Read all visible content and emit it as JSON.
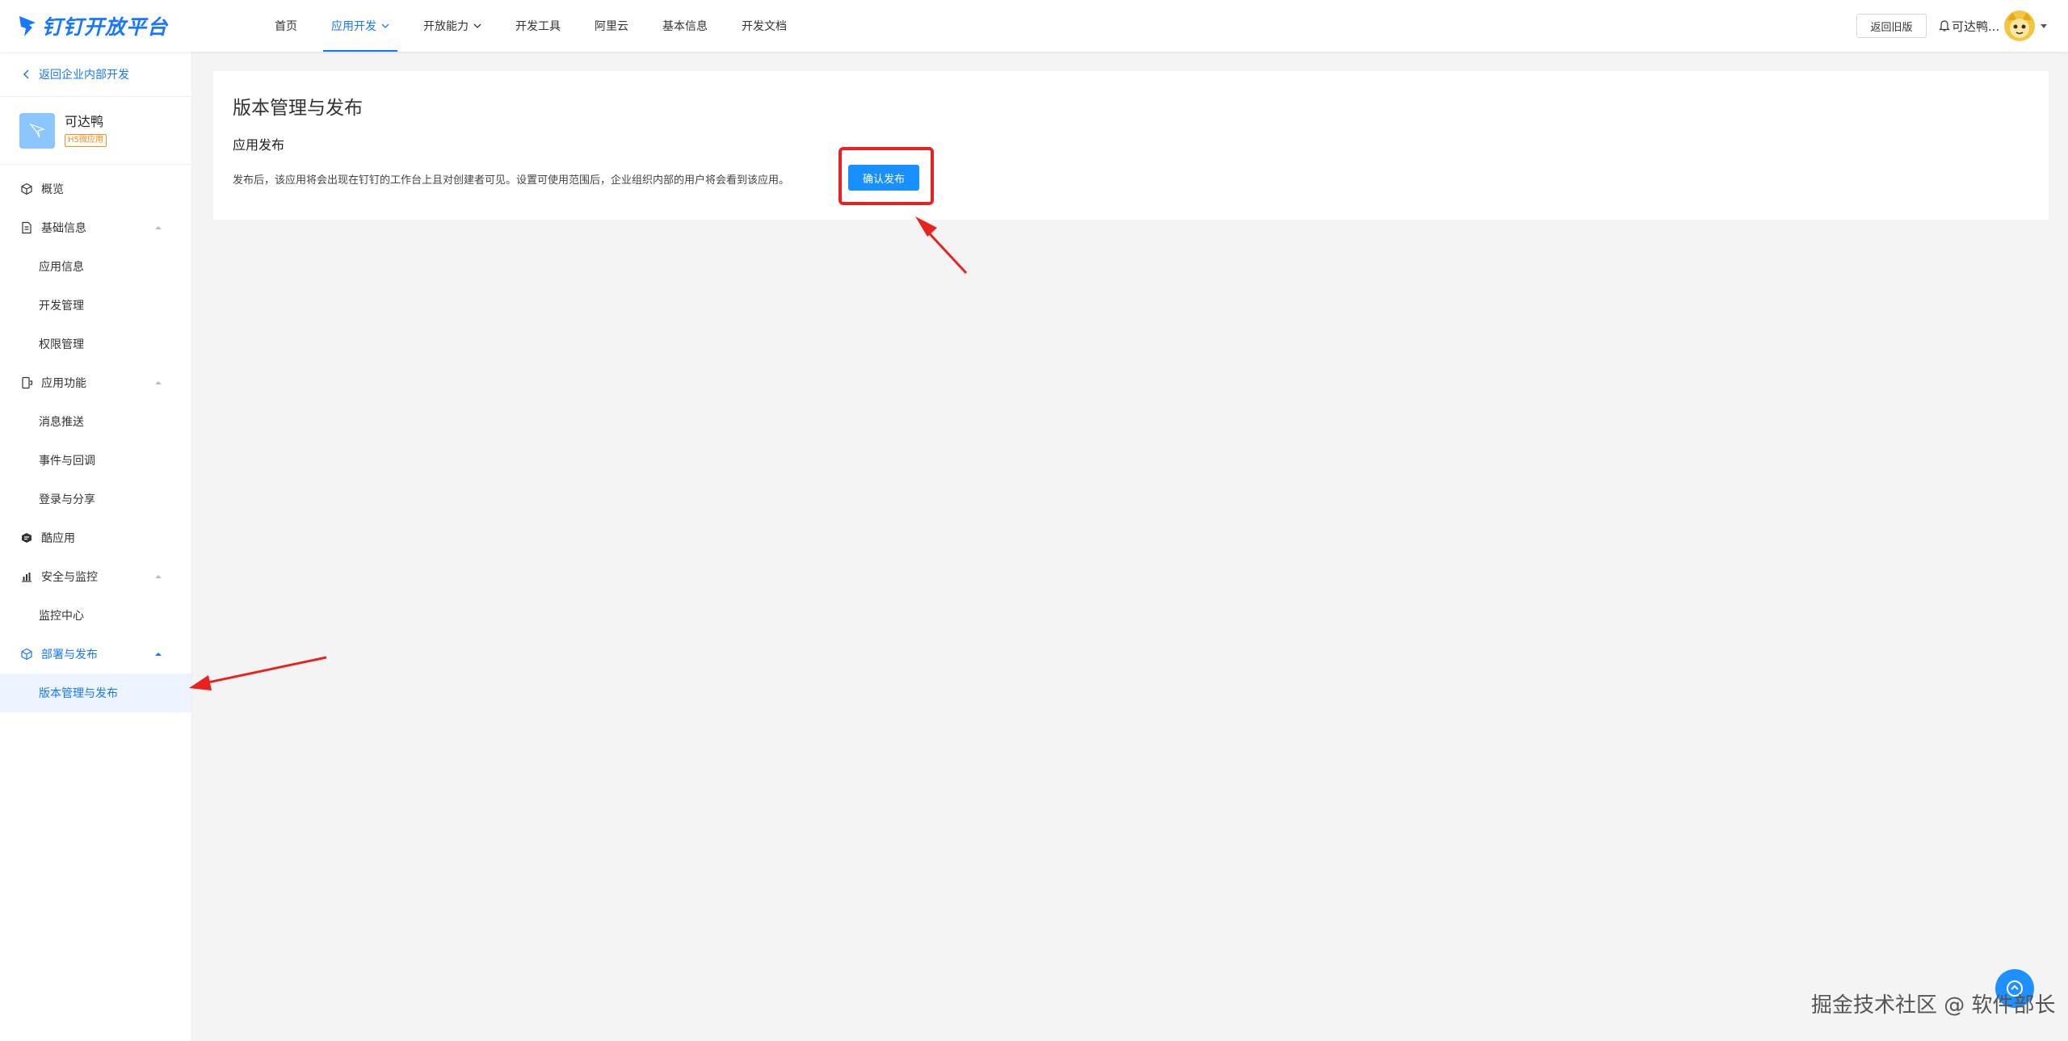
{
  "brand": {
    "name": "钉钉开放平台",
    "color": "#1677ff"
  },
  "nav": {
    "items": [
      {
        "label": "首页",
        "active": false,
        "dropdown": false
      },
      {
        "label": "应用开发",
        "active": true,
        "dropdown": true
      },
      {
        "label": "开放能力",
        "active": false,
        "dropdown": true
      },
      {
        "label": "开发工具",
        "active": false,
        "dropdown": false
      },
      {
        "label": "阿里云",
        "active": false,
        "dropdown": false
      },
      {
        "label": "基本信息",
        "active": false,
        "dropdown": false
      },
      {
        "label": "开发文档",
        "active": false,
        "dropdown": false
      }
    ],
    "old_version_label": "返回旧版",
    "user_name": "可达鸭..."
  },
  "sidebar": {
    "back_label": "返回企业内部开发",
    "app": {
      "name": "可达鸭",
      "badge": "H5微应用"
    },
    "menu": [
      {
        "type": "group",
        "label": "概览",
        "icon": "cube-icon"
      },
      {
        "type": "group",
        "label": "基础信息",
        "icon": "document-icon",
        "arrow": "up"
      },
      {
        "type": "sub",
        "label": "应用信息"
      },
      {
        "type": "sub",
        "label": "开发管理"
      },
      {
        "type": "sub",
        "label": "权限管理"
      },
      {
        "type": "group",
        "label": "应用功能",
        "icon": "phone-icon",
        "arrow": "up"
      },
      {
        "type": "sub",
        "label": "消息推送"
      },
      {
        "type": "sub",
        "label": "事件与回调"
      },
      {
        "type": "sub",
        "label": "登录与分享"
      },
      {
        "type": "group",
        "label": "酷应用",
        "icon": "cool-app-icon"
      },
      {
        "type": "group",
        "label": "安全与监控",
        "icon": "bar-chart-icon",
        "arrow": "up"
      },
      {
        "type": "sub",
        "label": "监控中心"
      },
      {
        "type": "group",
        "label": "部署与发布",
        "icon": "deploy-icon",
        "arrow": "up",
        "active": true
      },
      {
        "type": "sub",
        "label": "版本管理与发布",
        "active": true
      }
    ]
  },
  "main": {
    "title": "版本管理与发布",
    "section_title": "应用发布",
    "description": "发布后，该应用将会出现在钉钉的工作台上且对创建者可见。设置可使用范围后，企业组织内部的用户将会看到该应用。",
    "publish_button": "确认发布"
  },
  "annotation_color": "#e8231f",
  "watermark": "掘金技术社区 @ 软件部长"
}
